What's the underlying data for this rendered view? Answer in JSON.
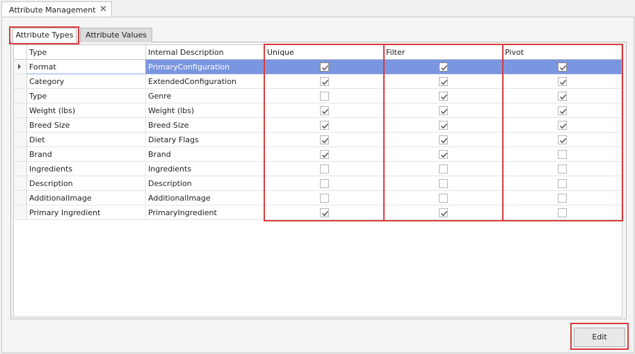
{
  "window": {
    "doc_tab_label": "Attribute Management",
    "close_glyph": "✕"
  },
  "tabs": [
    {
      "label": "Attribute Types",
      "active": true
    },
    {
      "label": "Attribute Values",
      "active": false
    }
  ],
  "grid": {
    "columns": [
      "Type",
      "Internal Description",
      "Unique",
      "Filter",
      "Pivot"
    ],
    "selected_row": 0,
    "rows": [
      {
        "type": "Format",
        "desc": "PrimaryConfiguration",
        "unique": true,
        "filter": true,
        "pivot": true
      },
      {
        "type": "Category",
        "desc": "ExtendedConfiguration",
        "unique": true,
        "filter": true,
        "pivot": true
      },
      {
        "type": "Type",
        "desc": "Genre",
        "unique": false,
        "filter": true,
        "pivot": true
      },
      {
        "type": "Weight (lbs)",
        "desc": "Weight (lbs)",
        "unique": true,
        "filter": true,
        "pivot": true
      },
      {
        "type": "Breed Size",
        "desc": "Breed Size",
        "unique": true,
        "filter": true,
        "pivot": true
      },
      {
        "type": "Diet",
        "desc": "Dietary Flags",
        "unique": true,
        "filter": true,
        "pivot": true
      },
      {
        "type": "Brand",
        "desc": "Brand",
        "unique": true,
        "filter": true,
        "pivot": false
      },
      {
        "type": "Ingredients",
        "desc": "Ingredients",
        "unique": false,
        "filter": false,
        "pivot": false
      },
      {
        "type": "Description",
        "desc": "Description",
        "unique": false,
        "filter": false,
        "pivot": false
      },
      {
        "type": "AdditionalImage",
        "desc": "AdditionalImage",
        "unique": false,
        "filter": false,
        "pivot": false
      },
      {
        "type": "Primary Ingredient",
        "desc": "PrimaryIngredient",
        "unique": true,
        "filter": true,
        "pivot": false
      }
    ]
  },
  "buttons": {
    "edit": "Edit"
  },
  "colors": {
    "highlight": "#d93a3a",
    "selection": "#7b96e0"
  }
}
